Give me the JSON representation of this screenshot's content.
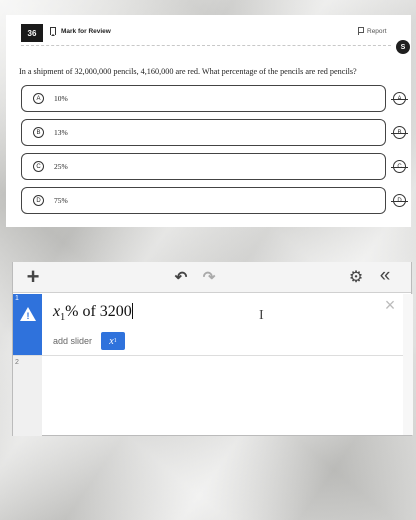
{
  "question": {
    "number": "36",
    "mark_for_review": "Mark for Review",
    "report": "Report",
    "abc_toggle": "S",
    "text": "In a shipment of 32,000,000 pencils, 4,160,000 are red. What percentage of the pencils are red pencils?",
    "options": [
      {
        "letter": "A",
        "text": "10%"
      },
      {
        "letter": "B",
        "text": "13%"
      },
      {
        "letter": "C",
        "text": "25%"
      },
      {
        "letter": "D",
        "text": "75%"
      }
    ]
  },
  "calculator": {
    "row_numbers": [
      "1",
      "2"
    ],
    "expression": {
      "var": "x",
      "subscript": "1",
      "rest": "% of 3200"
    },
    "add_slider_label": "add slider",
    "slider_chip": {
      "var": "x",
      "subscript": "1"
    },
    "icons": [
      "plus-icon",
      "undo-icon",
      "redo-icon",
      "gear-icon",
      "collapse-icon",
      "warning-icon",
      "close-icon"
    ]
  }
}
